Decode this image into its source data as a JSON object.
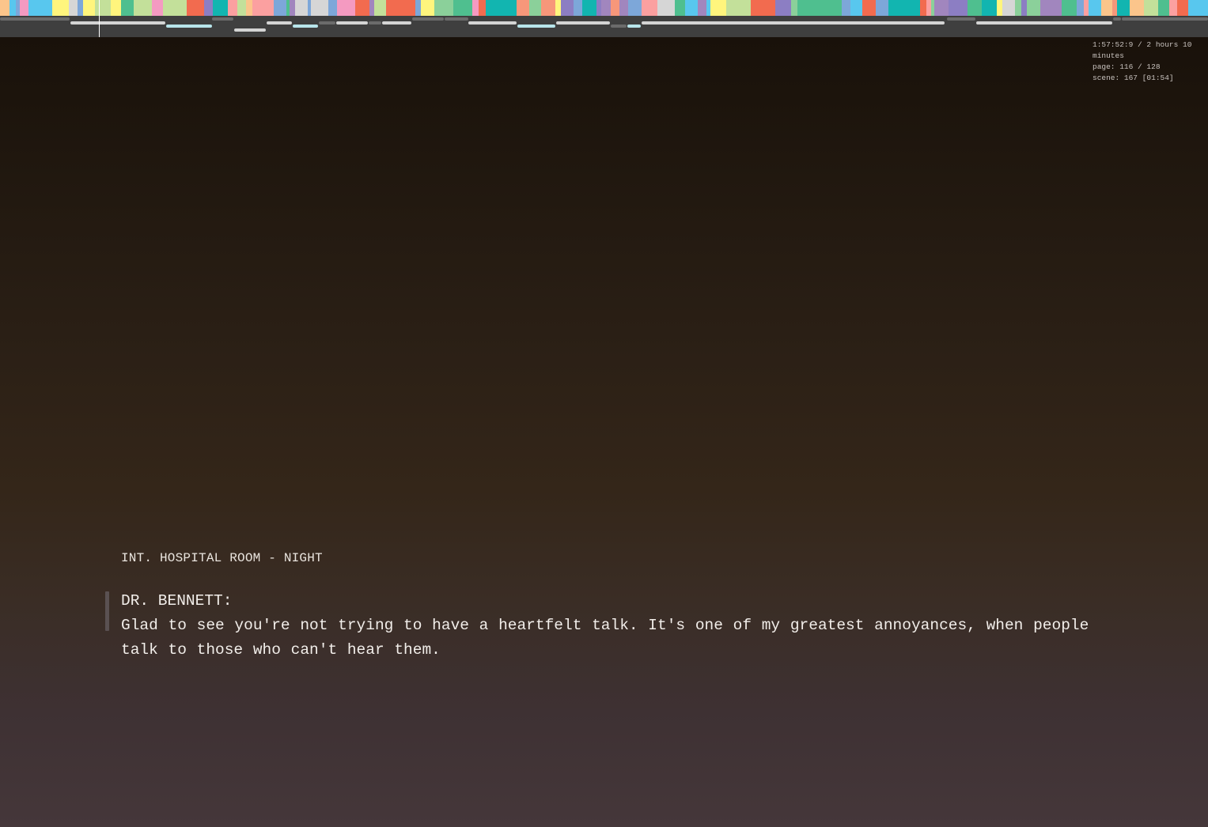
{
  "status": {
    "time": "1:57:52:9 / 2 hours 10 minutes",
    "page": "page: 116 / 128",
    "scene": "scene: 167 [01:54]"
  },
  "script": {
    "scene_heading": "INT. HOSPITAL ROOM - NIGHT",
    "character": "DR. BENNETT:",
    "dialogue": "Glad to see you're not trying to have a heartfelt talk. It's one of my greatest annoyances, when people talk to those who can't hear them."
  },
  "timeline": {
    "palette": [
      "#f26b4f",
      "#fbc58b",
      "#fff57d",
      "#c3e09a",
      "#8bd09a",
      "#4fbf8f",
      "#12b5b0",
      "#58c7ee",
      "#7da7d9",
      "#8c7ec3",
      "#a186be",
      "#f49ac1",
      "#fba0a0",
      "#f7977a",
      "#d6d6d6"
    ],
    "track_colors": {
      "light": "#d4d4d4",
      "cyan": "#b7e4ea",
      "dark": "#6b6b6b"
    },
    "progress": 0.082
  }
}
